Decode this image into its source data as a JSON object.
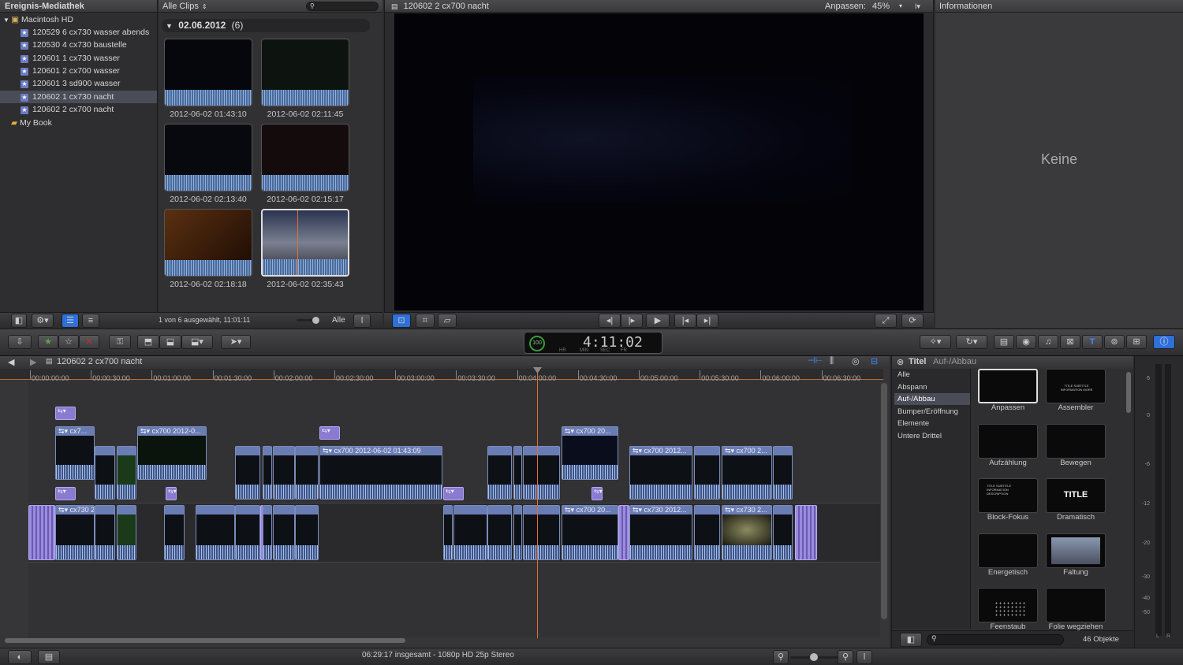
{
  "library": {
    "title": "Ereignis-Mediathek",
    "disk": "Macintosh HD",
    "events": [
      "120529 6 cx730 wasser abends",
      "120530 4 cx730 baustelle",
      "120601 1 cx730 wasser",
      "120601 2 cx700 wasser",
      "120601 3 sd900 wasser",
      "120602 1 cx730 nacht",
      "120602 2 cx700 nacht"
    ],
    "selected_index": 5,
    "book": "My Book"
  },
  "browser": {
    "filter": "Alle Clips",
    "group_date": "02.06.2012",
    "group_count": "(6)",
    "clips": [
      "2012-06-02 01:43:10",
      "2012-06-02 02:11:45",
      "2012-06-02 02:13:40",
      "2012-06-02 02:15:17",
      "2012-06-02 02:18:18",
      "2012-06-02 02:35:43"
    ],
    "status": "1 von 6 ausgewählt, 11:01:11",
    "filter_all": "Alle"
  },
  "viewer": {
    "title": "120602 2 cx700 nacht",
    "zoom_label": "Anpassen:",
    "zoom_value": "45%"
  },
  "inspector": {
    "title": "Informationen",
    "empty": "Keine"
  },
  "timecode": {
    "percent": "100",
    "value": "4:11:02",
    "units": [
      "HR",
      "MIN",
      "SEC",
      "FR"
    ]
  },
  "timeline": {
    "project": "120602 2 cx700 nacht",
    "ruler": [
      "00:00:00:00",
      "00:00:30:00",
      "00:01:00:00",
      "00:01:30:00",
      "00:02:00:00",
      "00:02:30:00",
      "00:03:00:00",
      "00:03:30:00",
      "00:04:00:00",
      "00:04:30:00",
      "00:05:00:00",
      "00:05:30:00",
      "00:06:00:00",
      "00:06:30:00"
    ],
    "clip_labels": [
      "cx7...",
      "cx700 2012-0...",
      "cx700 2012-06-02 01:43:09",
      "cx700 20...",
      "cx700 2012...",
      "cx700 2...",
      "cx730 2012...",
      "cx730 2...",
      "cx7...",
      "cx700 20..."
    ],
    "status": "06:29:17 insgesamt - 1080p HD 25p Stereo"
  },
  "titles": {
    "header": "Titel",
    "subheader": "Auf-/Abbau",
    "categories": [
      "Alle",
      "Abspann",
      "Auf-/Abbau",
      "Bumper/Eröffnung",
      "Elemente",
      "Untere Drittel"
    ],
    "selected_category": 2,
    "items": [
      "Anpassen",
      "Assembler",
      "Aufzählung",
      "Bewegen",
      "Block-Fokus",
      "Dramatisch",
      "Energetisch",
      "Faltung",
      "Feenstaub",
      "Folie wegziehen"
    ],
    "thumb_texts": {
      "assembler": "TITLE SUBTITLE INFORMATION MORE",
      "dramatic": "TITLE",
      "block": "TITLE SUBTITLE INFORMATION DESCRIPTION"
    },
    "count": "46 Objekte"
  },
  "meter": {
    "scale": [
      "6",
      "0",
      "-6",
      "-12",
      "-20",
      "-30",
      "-40",
      "-50"
    ],
    "channels": [
      "L",
      "R"
    ]
  },
  "colors": {
    "accent": "#2f6fd8",
    "playhead": "#e0703a",
    "clip": "#6a7cb4",
    "transition": "#8a7ad0"
  }
}
